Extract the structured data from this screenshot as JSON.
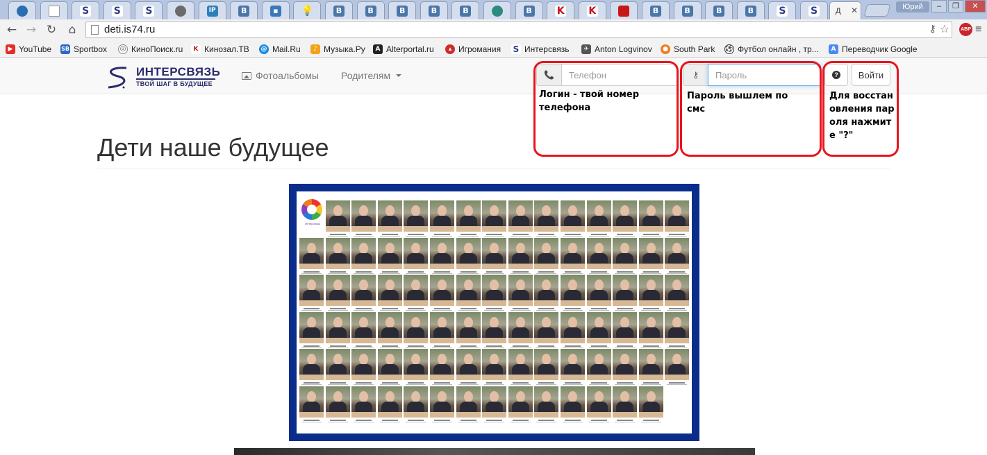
{
  "browser": {
    "tabs": [
      {
        "icon": "globe-icon"
      },
      {
        "icon": "document-icon"
      },
      {
        "icon": "intersvyaz-icon"
      },
      {
        "icon": "intersvyaz-icon"
      },
      {
        "icon": "intersvyaz-icon"
      },
      {
        "icon": "person-icon"
      },
      {
        "icon": "ip-icon"
      },
      {
        "icon": "vk-icon"
      },
      {
        "icon": "speech-icon"
      },
      {
        "icon": "bulb-icon"
      },
      {
        "icon": "vk-icon"
      },
      {
        "icon": "vk-icon"
      },
      {
        "icon": "vk-icon"
      },
      {
        "icon": "vk-icon"
      },
      {
        "icon": "vk-icon"
      },
      {
        "icon": "leaf-icon"
      },
      {
        "icon": "vk-icon"
      },
      {
        "icon": "kinozal-icon"
      },
      {
        "icon": "kinozal-icon"
      },
      {
        "icon": "flag-icon"
      },
      {
        "icon": "vk-icon"
      },
      {
        "icon": "vk-icon"
      },
      {
        "icon": "vk-icon"
      },
      {
        "icon": "vk-icon"
      },
      {
        "icon": "intersvyaz-icon"
      },
      {
        "icon": "intersvyaz-icon"
      }
    ],
    "active_tab_title": "Д",
    "profile_name": "Юрий",
    "url": "deti.is74.ru",
    "abp_label": "ABP",
    "bookmarks": [
      {
        "label": "YouTube",
        "icon": "youtube-icon"
      },
      {
        "label": "Sportbox",
        "icon": "sportbox-icon"
      },
      {
        "label": "КиноПоиск.ru",
        "icon": "kinopoisk-icon"
      },
      {
        "label": "Кинозал.ТВ",
        "icon": "kinozal-icon"
      },
      {
        "label": "Mail.Ru",
        "icon": "mailru-icon"
      },
      {
        "label": "Музыка.Ру",
        "icon": "music-icon"
      },
      {
        "label": "Alterportal.ru",
        "icon": "alterportal-icon"
      },
      {
        "label": "Игромания",
        "icon": "igromania-icon"
      },
      {
        "label": "Интерсвязь",
        "icon": "intersvyaz-icon"
      },
      {
        "label": "Anton Logvinov",
        "icon": "anton-icon"
      },
      {
        "label": "South Park",
        "icon": "southpark-icon"
      },
      {
        "label": "Футбол онлайн , тр...",
        "icon": "football-icon"
      },
      {
        "label": "Переводчик Google",
        "icon": "google-translate-icon"
      }
    ]
  },
  "site": {
    "logo_title": "ИНТЕРСВЯЗЬ",
    "logo_subtitle": "ТВОЙ ШАГ В БУДУЩЕЕ",
    "nav": {
      "albums": "Фотоальбомы",
      "parents": "Родителям"
    },
    "login": {
      "phone_placeholder": "Телефон",
      "password_placeholder": "Пароль",
      "help_label": "?",
      "submit_label": "Войти"
    },
    "annotations": {
      "phone_note": "Логин - твой номер телефона",
      "password_note": "Пароль вышлем по смс",
      "help_note": "Для восстановления пароля нажмите \"?\""
    },
    "page_title": "Дети наше будущее",
    "poster": {
      "caption": "Интерсвязь"
    }
  }
}
